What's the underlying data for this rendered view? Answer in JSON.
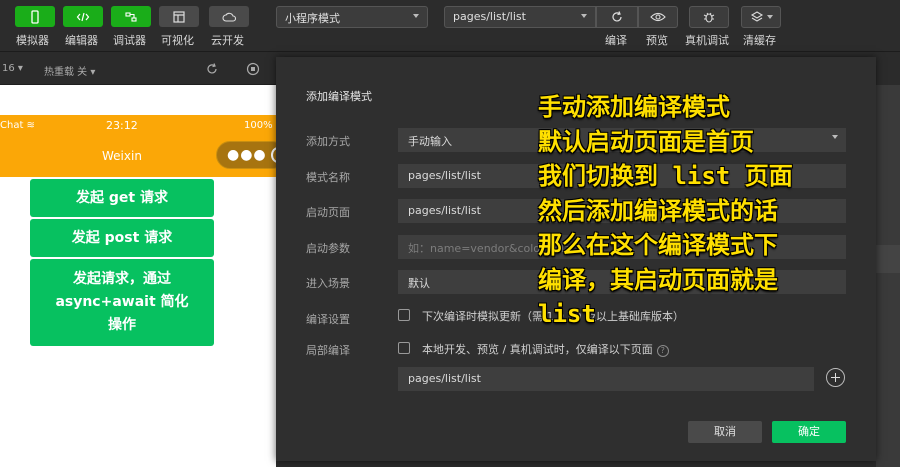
{
  "toolbar": {
    "buttons": [
      {
        "label": "模拟器",
        "icon": "phone-icon"
      },
      {
        "label": "编辑器",
        "icon": "code-icon"
      },
      {
        "label": "调试器",
        "icon": "debug-icon"
      },
      {
        "label": "可视化",
        "icon": "layout-icon"
      },
      {
        "label": "云开发",
        "icon": "cloud-icon"
      }
    ],
    "mode_select": "小程序模式",
    "page_select": "pages/list/list",
    "compile_label": "编译",
    "preview_label": "预览",
    "remote_debug_label": "真机调试",
    "clear_cache_label": "清缓存"
  },
  "subbar": {
    "zoom": "16",
    "hot_reload": "热重载 关"
  },
  "simulator": {
    "status_left": "Chat",
    "status_time": "23:12",
    "status_battery": "100%",
    "nav_title": "Weixin",
    "buttons": [
      "发起 get 请求",
      "发起 post 请求",
      "发起请求，通过 async+await 简化操作"
    ]
  },
  "dialog": {
    "title": "添加编译模式",
    "fields": {
      "method_label": "添加方式",
      "method_value": "手动输入",
      "name_label": "模式名称",
      "name_value": "pages/list/list",
      "start_page_label": "启动页面",
      "start_page_value": "pages/list/list",
      "params_label": "启动参数",
      "params_placeholder": "如：name=vendor&color=black",
      "scene_label": "进入场景",
      "scene_value": "默认",
      "compile_setting_label": "编译设置",
      "compile_setting_text": "下次编译时模拟更新（需 1.9.90 及以上基础库版本）",
      "partial_label": "局部编译",
      "partial_text": "本地开发、预览 / 真机调试时，仅编译以下页面",
      "partial_page": "pages/list/list"
    },
    "cancel_label": "取消",
    "ok_label": "确定"
  },
  "annotation": "手动添加编译模式\n默认启动页面是首页\n我们切换到 list 页面\n然后添加编译模式的话\n那么在这个编译模式下\n编译，其启动页面就是\nlist"
}
